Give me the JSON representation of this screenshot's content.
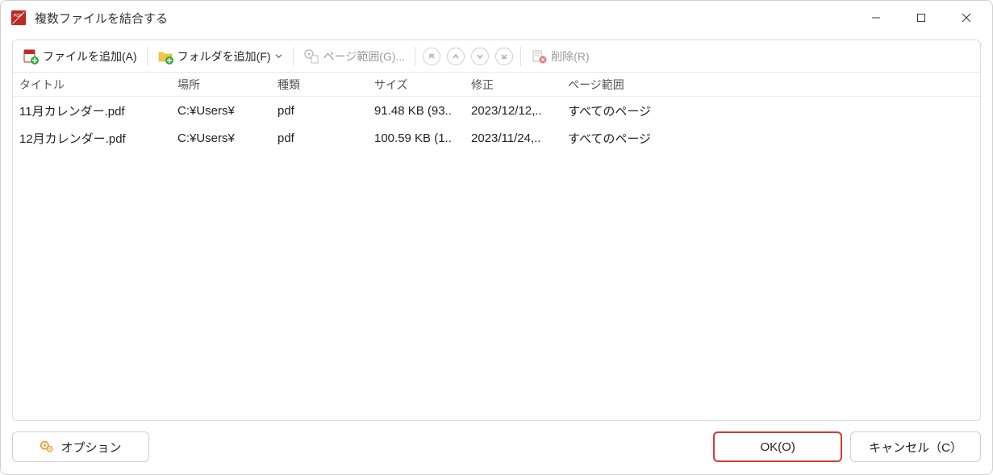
{
  "window": {
    "title": "複数ファイルを結合する"
  },
  "toolbar": {
    "add_file": "ファイルを追加(A)",
    "add_folder": "フォルダを追加(F)",
    "page_range": "ページ範囲(G)...",
    "delete": "削除(R)"
  },
  "columns": {
    "title": "タイトル",
    "location": "場所",
    "type": "種類",
    "size": "サイズ",
    "modified": "修正",
    "page_range": "ページ範囲"
  },
  "rows": [
    {
      "title": "11月カレンダー.pdf",
      "location": "C:¥Users¥",
      "type": "pdf",
      "size": "91.48 KB (93..",
      "modified": "2023/12/12,..",
      "page_range": "すべてのページ"
    },
    {
      "title": "12月カレンダー.pdf",
      "location": "C:¥Users¥",
      "type": "pdf",
      "size": "100.59 KB (1..",
      "modified": "2023/11/24,..",
      "page_range": "すべてのページ"
    }
  ],
  "footer": {
    "options": "オプション",
    "ok": "OK(O)",
    "cancel": "キャンセル（C）"
  }
}
